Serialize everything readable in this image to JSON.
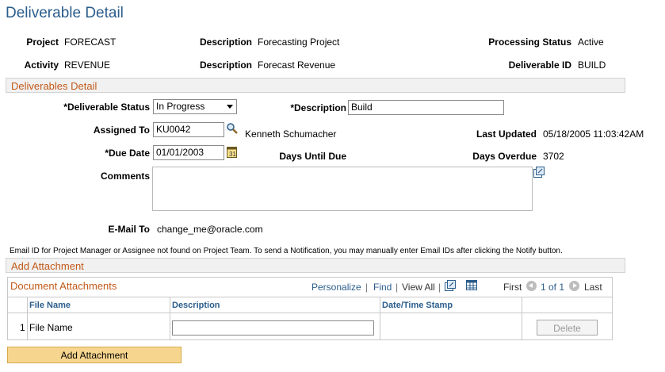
{
  "page": {
    "title": "Deliverable Detail"
  },
  "header": {
    "project_label": "Project",
    "project_value": "FORECAST",
    "description1_label": "Description",
    "description1_value": "Forecasting Project",
    "processing_status_label": "Processing Status",
    "processing_status_value": "Active",
    "activity_label": "Activity",
    "activity_value": "REVENUE",
    "description2_label": "Description",
    "description2_value": "Forecast Revenue",
    "deliverable_id_label": "Deliverable ID",
    "deliverable_id_value": "BUILD"
  },
  "deliverables_detail": {
    "section_title": "Deliverables Detail",
    "status_label": "*Deliverable Status",
    "status_value": "In Progress",
    "description_label": "*Description",
    "description_value": "Build",
    "assigned_to_label": "Assigned To",
    "assigned_to_value": "KU0042",
    "assigned_to_name": "Kenneth Schumacher",
    "last_updated_label": "Last Updated",
    "last_updated_value": "05/18/2005 11:03:42AM",
    "due_date_label": "*Due Date",
    "due_date_value": "01/01/2003",
    "days_until_due_label": "Days Until Due",
    "days_overdue_label": "Days Overdue",
    "days_overdue_value": "3702",
    "comments_label": "Comments",
    "comments_value": "",
    "email_to_label": "E-Mail To",
    "email_to_value": "change_me@oracle.com",
    "notice": "Email ID for Project Manager or Assignee not found on Project Team.  To send a Notification, you may manually enter Email IDs after clicking the Notify button."
  },
  "add_attachment_section": {
    "title": "Add Attachment"
  },
  "attachments_grid": {
    "title": "Document Attachments",
    "personalize": "Personalize",
    "sep1": "|",
    "find": "Find",
    "sep2": "|",
    "view_all": "View All",
    "sep3": "|",
    "first": "First",
    "range": "1 of 1",
    "last": "Last",
    "columns": [
      "File Name",
      "Description",
      "Date/Time Stamp"
    ],
    "rows": [
      {
        "num": "1",
        "file_name": "File Name",
        "description": "",
        "timestamp": "",
        "delete_label": "Delete"
      }
    ]
  },
  "buttons": {
    "add_attachment": "Add Attachment"
  },
  "colors": {
    "title": "#2b5d8c",
    "section": "#c25a1a",
    "button_fill": "#f6d68f"
  },
  "icons": {
    "lookup": "magnifier-icon",
    "calendar": "calendar-icon",
    "expand": "expand-icon",
    "grid_zoom": "zoom-grid-icon",
    "grid_download": "spreadsheet-icon"
  }
}
